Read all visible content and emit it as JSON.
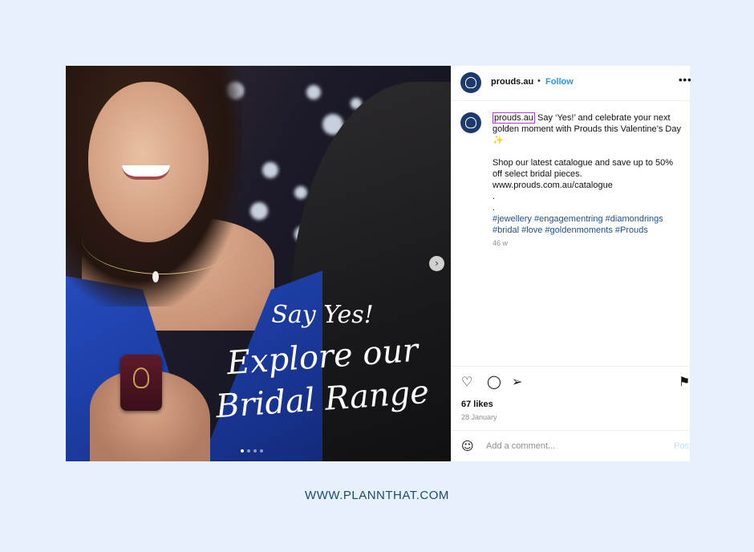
{
  "image": {
    "overlay_line1": "Say Yes!",
    "overlay_line2": "Explore our",
    "overlay_line3": "Bridal Range",
    "carousel_dots": 4,
    "carousel_active_index": 0
  },
  "header": {
    "username": "prouds.au",
    "separator": "•",
    "follow_label": "Follow",
    "more_label": "•••"
  },
  "caption": {
    "username": "prouds.au",
    "line1": " Say ‘Yes!’ and celebrate your next golden moment with Prouds this Valentine’s Day ✨",
    "line2": "Shop our latest catalogue and save up to 50% off select bridal pieces.",
    "link": "www.prouds.com.au/catalogue",
    "dot1": ".",
    "dot2": ".",
    "hashtags": "#jewellery #engagementring #diamondrings #bridal #love #goldenmoments #Prouds",
    "age": "46 w"
  },
  "actions": {
    "like_icon": "♡",
    "comment_icon": "◯",
    "share_icon": "➢",
    "save_icon": "⚑"
  },
  "stats": {
    "likes": "67 likes",
    "date": "28 January"
  },
  "comment": {
    "emoji_icon": "☺",
    "placeholder": "Add a comment...",
    "post_label": "Post"
  },
  "footer": {
    "text": "WWW.PLANNTHAT.COM"
  },
  "colors": {
    "background": "#e6f1fd",
    "follow": "#1f9af2",
    "hashtag": "#1f4e8c",
    "footer": "#1c4a6e"
  }
}
